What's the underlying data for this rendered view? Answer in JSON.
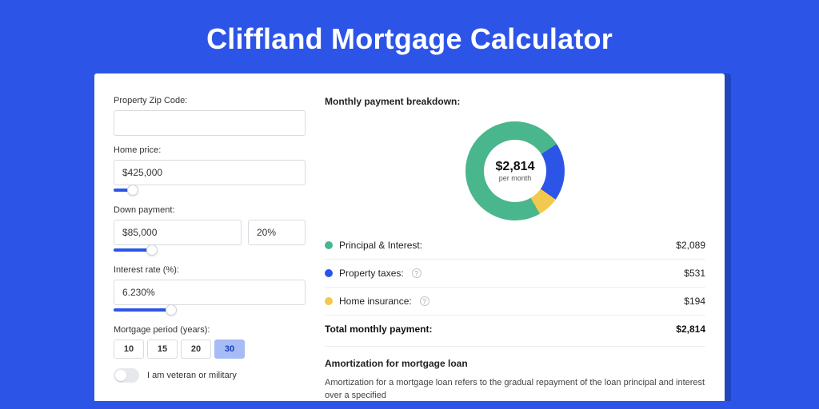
{
  "title": "Cliffland Mortgage Calculator",
  "colors": {
    "bg": "#2c55e8",
    "principal": "#49b68d",
    "taxes": "#2c55e8",
    "insurance": "#f2c94c"
  },
  "form": {
    "zip": {
      "label": "Property Zip Code:",
      "value": ""
    },
    "price": {
      "label": "Home price:",
      "value": "$425,000",
      "slider_percent": 10
    },
    "down": {
      "label": "Down payment:",
      "amount": "$85,000",
      "percent": "20%",
      "slider_percent": 20
    },
    "rate": {
      "label": "Interest rate (%):",
      "value": "6.230%",
      "slider_percent": 30
    },
    "period": {
      "label": "Mortgage period (years):",
      "options": [
        "10",
        "15",
        "20",
        "30"
      ],
      "selected": "30"
    },
    "veteran": {
      "label": "I am veteran or military",
      "on": false
    }
  },
  "breakdown": {
    "title": "Monthly payment breakdown:",
    "center_amount": "$2,814",
    "center_caption": "per month",
    "items": [
      {
        "name": "Principal & Interest:",
        "value": "$2,089",
        "colorKey": "principal",
        "pct": 74.2,
        "help": false
      },
      {
        "name": "Property taxes:",
        "value": "$531",
        "colorKey": "taxes",
        "pct": 18.9,
        "help": true
      },
      {
        "name": "Home insurance:",
        "value": "$194",
        "colorKey": "insurance",
        "pct": 6.9,
        "help": true
      }
    ],
    "total_label": "Total monthly payment:",
    "total_value": "$2,814"
  },
  "amort": {
    "title": "Amortization for mortgage loan",
    "text": "Amortization for a mortgage loan refers to the gradual repayment of the loan principal and interest over a specified"
  },
  "chart_data": {
    "type": "pie",
    "title": "Monthly payment breakdown",
    "series": [
      {
        "name": "Principal & Interest",
        "value": 2089,
        "color": "#49b68d"
      },
      {
        "name": "Property taxes",
        "value": 531,
        "color": "#2c55e8"
      },
      {
        "name": "Home insurance",
        "value": 194,
        "color": "#f2c94c"
      }
    ],
    "total": 2814,
    "center_label": "$2,814 per month"
  }
}
